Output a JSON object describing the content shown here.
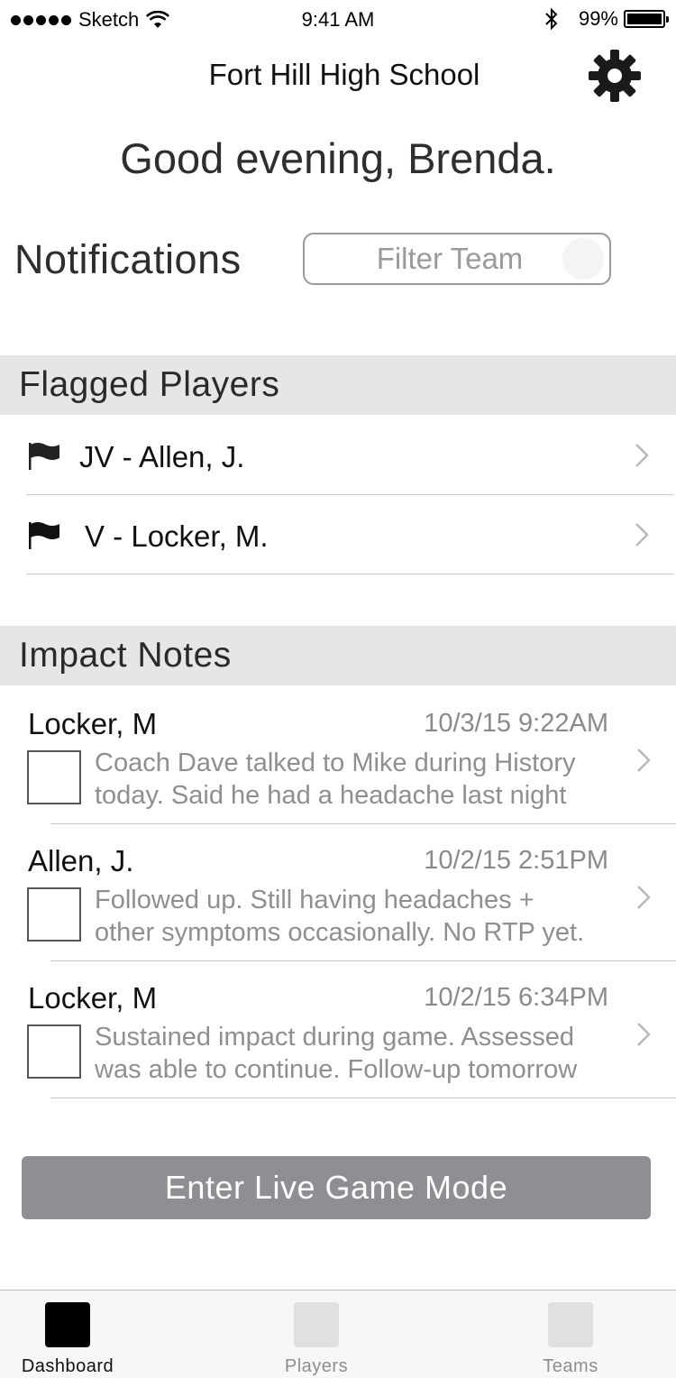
{
  "status_bar": {
    "carrier": "Sketch",
    "time": "9:41 AM",
    "battery": "99%",
    "battery_level": 0.99
  },
  "header": {
    "title": "Fort Hill High School",
    "settings_icon": "gear-icon"
  },
  "greeting": "Good evening, Brenda.",
  "notifications": {
    "title": "Notifications",
    "filter_placeholder": "Filter Team"
  },
  "flagged_players": {
    "title": "Flagged Players",
    "items": [
      {
        "label": "JV - Allen, J.",
        "icon": "flag-icon"
      },
      {
        "label": "V - Locker, M.",
        "icon": "flag-icon"
      }
    ]
  },
  "impact_notes": {
    "title": "Impact Notes",
    "items": [
      {
        "name": "Locker, M",
        "timestamp": "10/3/15 9:22AM",
        "line1": "Coach Dave talked to Mike during History",
        "line2": "today. Said he had a headache last night",
        "checked": false
      },
      {
        "name": "Allen, J.",
        "timestamp": "10/2/15 2:51PM",
        "line1": "Followed up. Still having headaches +",
        "line2": "other symptoms occasionally. No RTP yet.",
        "checked": false
      },
      {
        "name": "Locker, M",
        "timestamp": "10/2/15 6:34PM",
        "line1": "Sustained impact during game. Assessed",
        "line2": "was able to continue. Follow-up tomorrow",
        "checked": false
      }
    ]
  },
  "live_game_button": "Enter Live Game Mode",
  "tab_bar": {
    "items": [
      {
        "label": "Dashboard",
        "active": true
      },
      {
        "label": "Players",
        "active": false
      },
      {
        "label": "Teams",
        "active": false
      }
    ]
  },
  "colors": {
    "section_header_bg": "#e6e6e6",
    "button_bg": "#8e8e93",
    "muted_text": "#8f8f8f"
  }
}
